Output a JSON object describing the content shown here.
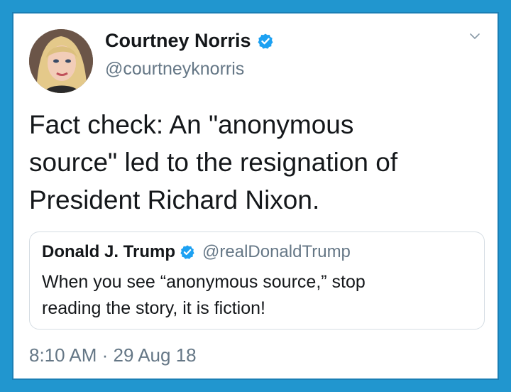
{
  "tweet": {
    "author": {
      "display_name": "Courtney Norris",
      "handle": "@courtneyknorris",
      "verified": true
    },
    "text": "Fact check: An \"anonymous\nsource\" led to the resignation of\nPresident Richard Nixon.",
    "timestamp": "8:10 AM · 29 Aug 18"
  },
  "quoted_tweet": {
    "display_name": "Donald J. Trump",
    "handle": "@realDonaldTrump",
    "verified": true,
    "text": "When you see “anonymous source,” stop\nreading the story, it is fiction!"
  },
  "colors": {
    "frame_blue": "#2196cf",
    "verified_blue": "#1da1f2",
    "secondary_text": "#657786"
  },
  "icons": {
    "verified": "verified-badge-icon",
    "menu": "chevron-down-icon"
  }
}
